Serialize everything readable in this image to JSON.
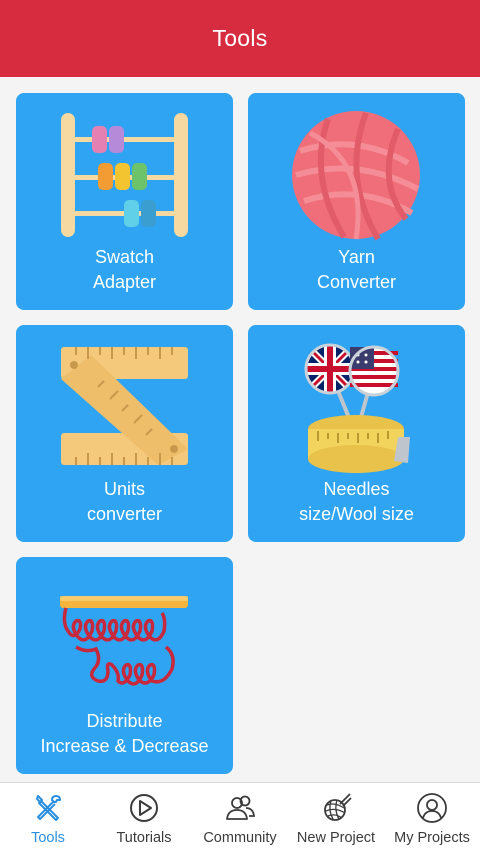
{
  "header": {
    "title": "Tools"
  },
  "cards": [
    {
      "id": "swatch",
      "line1": "Swatch",
      "line2": "Adapter",
      "icon": "abacus-icon"
    },
    {
      "id": "yarn",
      "line1": "Yarn",
      "line2": "Converter",
      "icon": "yarn-ball-icon"
    },
    {
      "id": "units",
      "line1": "Units",
      "line2": "converter",
      "icon": "folding-ruler-icon"
    },
    {
      "id": "needles",
      "line1": "Needles",
      "line2": "size/Wool size",
      "icon": "needles-measuring-tape-icon"
    },
    {
      "id": "distribute",
      "line1": "Distribute",
      "line2": "Increase & Decrease",
      "icon": "knitting-stitches-icon"
    }
  ],
  "tabs": [
    {
      "label": "Tools",
      "icon": "tools-icon",
      "active": true
    },
    {
      "label": "Tutorials",
      "icon": "play-icon",
      "active": false
    },
    {
      "label": "Community",
      "icon": "community-icon",
      "active": false
    },
    {
      "label": "New Project",
      "icon": "yarn-needles-icon",
      "active": false
    },
    {
      "label": "My Projects",
      "icon": "profile-icon",
      "active": false
    }
  ],
  "colors": {
    "header": "#d72b40",
    "card": "#2ea4f2",
    "active_tab": "#2b8fde",
    "inactive_tab": "#3b3b3b"
  }
}
